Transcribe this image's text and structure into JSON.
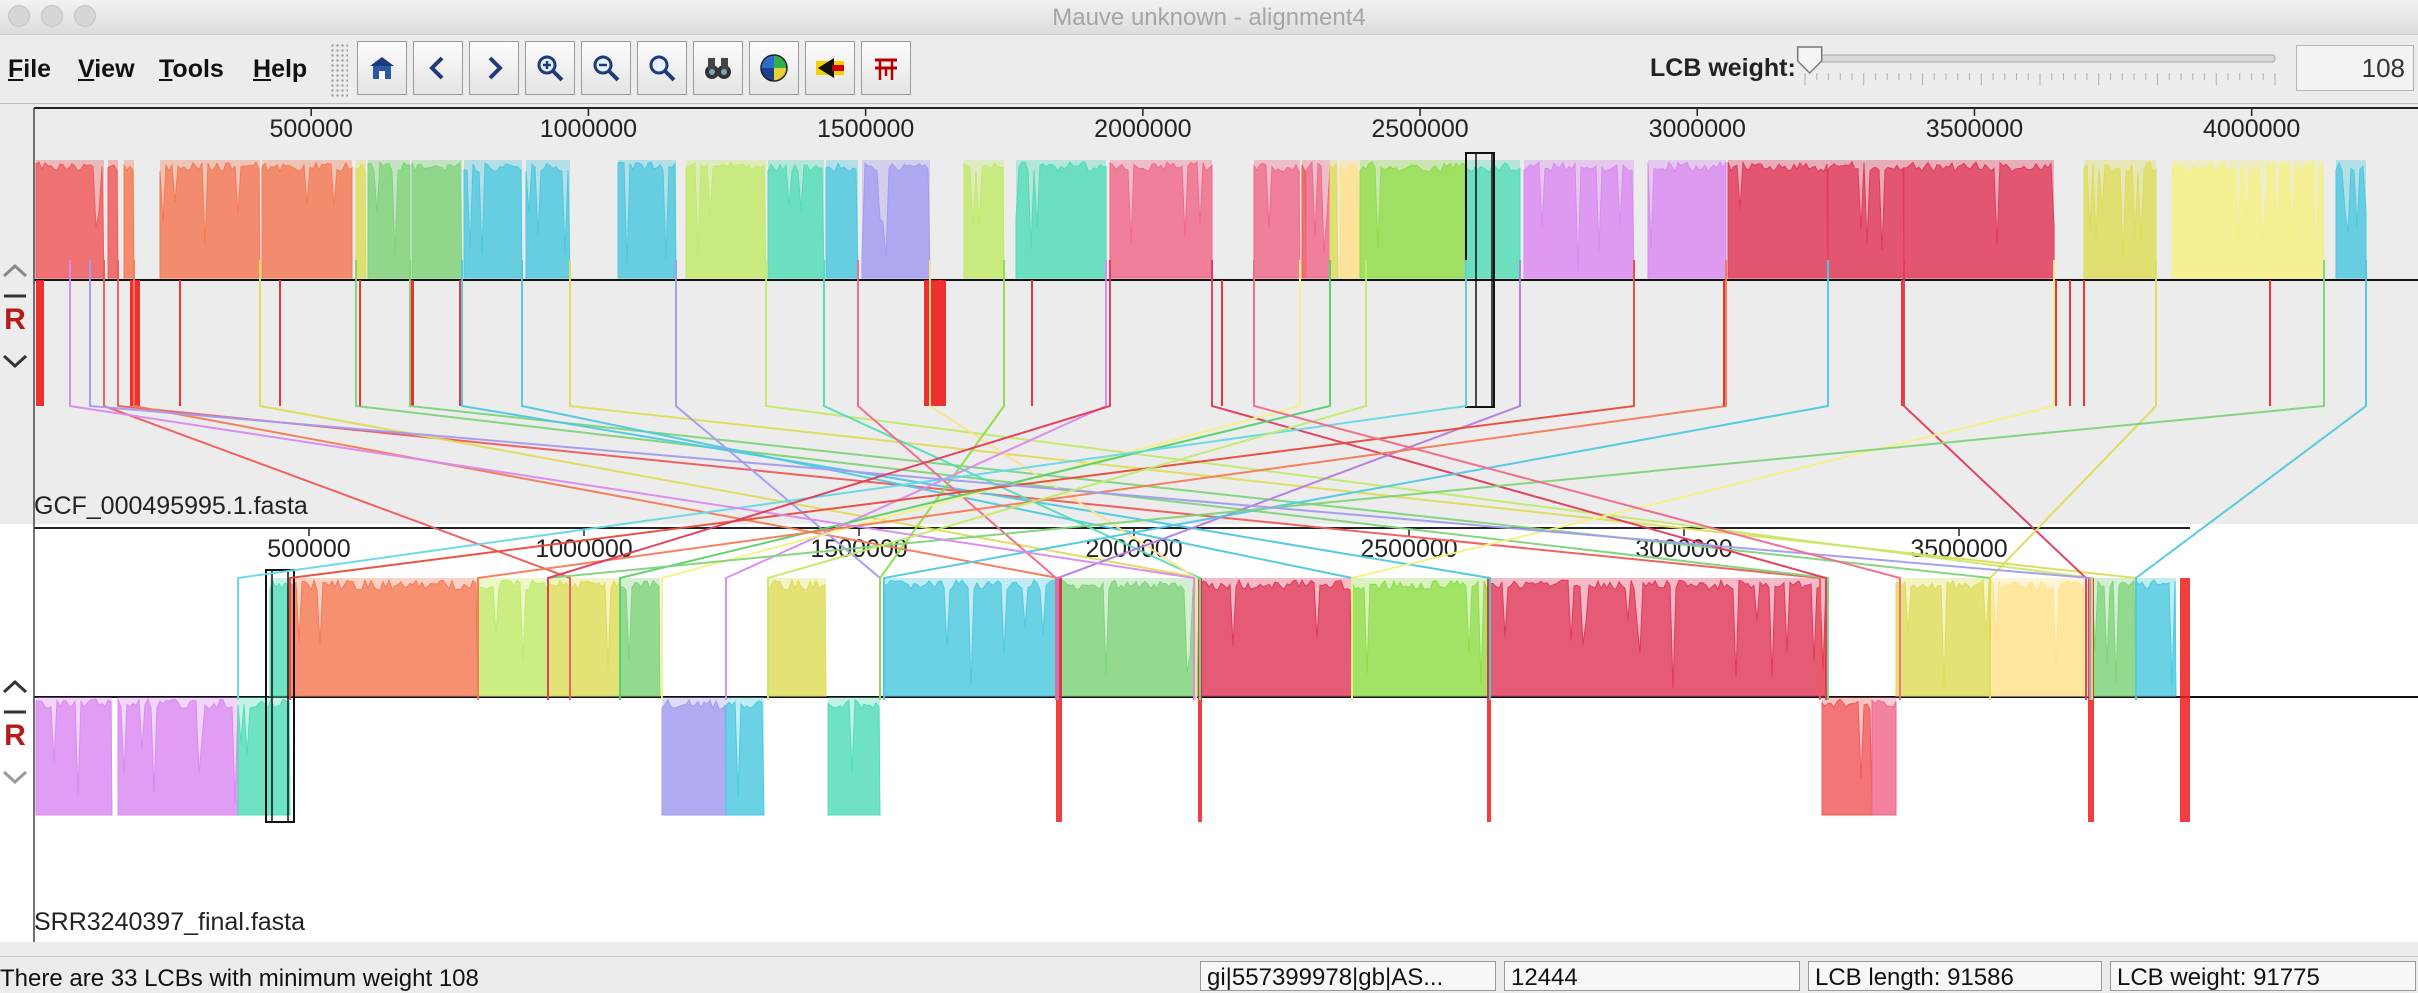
{
  "window": {
    "title": "Mauve unknown - alignment4"
  },
  "menu": [
    {
      "key": "F",
      "rest": "ile"
    },
    {
      "key": "V",
      "rest": "iew"
    },
    {
      "key": "T",
      "rest": "ools"
    },
    {
      "key": "H",
      "rest": "elp"
    }
  ],
  "toolbar": {
    "buttons": [
      "home-icon",
      "scroll-left-icon",
      "scroll-right-icon",
      "zoom-in-icon",
      "zoom-out-icon",
      "zoom-search-icon",
      "binoculars-icon",
      "color-wheel-icon",
      "arrow-left-highlight-icon",
      "align-bars-icon"
    ],
    "lcb_weight_label": "LCB weight:",
    "lcb_weight_value": "108",
    "slider_fraction": 0.01
  },
  "genomes": [
    {
      "name": "GCF_000495995.1.fasta",
      "ticks": [
        "500000",
        "1000000",
        "1500000",
        "2000000",
        "2500000",
        "3000000",
        "3500000",
        "4000000"
      ],
      "tick_values": [
        500000,
        1000000,
        1500000,
        2000000,
        2500000,
        3000000,
        3500000,
        4000000
      ],
      "length": 4300000,
      "controls": [
        "⌃",
        "−",
        "R",
        "⌄"
      ]
    },
    {
      "name": "SRR3240397_final.fasta",
      "ticks": [
        "500000",
        "1000000",
        "1500000",
        "2000000",
        "2500000",
        "3000000",
        "3500000"
      ],
      "tick_values": [
        500000,
        1000000,
        1500000,
        2000000,
        2500000,
        3000000,
        3500000
      ],
      "length": 3920000,
      "controls": [
        "⌃",
        "−",
        "R",
        "⌄"
      ]
    }
  ],
  "lcb_colors": [
    "#f05a5a",
    "#f47a55",
    "#dedc5a",
    "#7ed37a",
    "#4ec8e0",
    "#a29bf0",
    "#c2ea6a",
    "#52dcb7",
    "#f06a8a",
    "#ffe28a",
    "#8fdc4a",
    "#d98af0",
    "#e03a5a",
    "#f5f083",
    "#56d06a",
    "#66d8e8",
    "#b37ae0",
    "#e84a3a"
  ],
  "status": {
    "message": "There are 33 LCBs with minimum weight 108",
    "sequence": "gi|557399978|gb|AS...",
    "position": "12444",
    "lcb_length": "LCB length: 91586",
    "lcb_weight": "LCB weight: 91775"
  }
}
